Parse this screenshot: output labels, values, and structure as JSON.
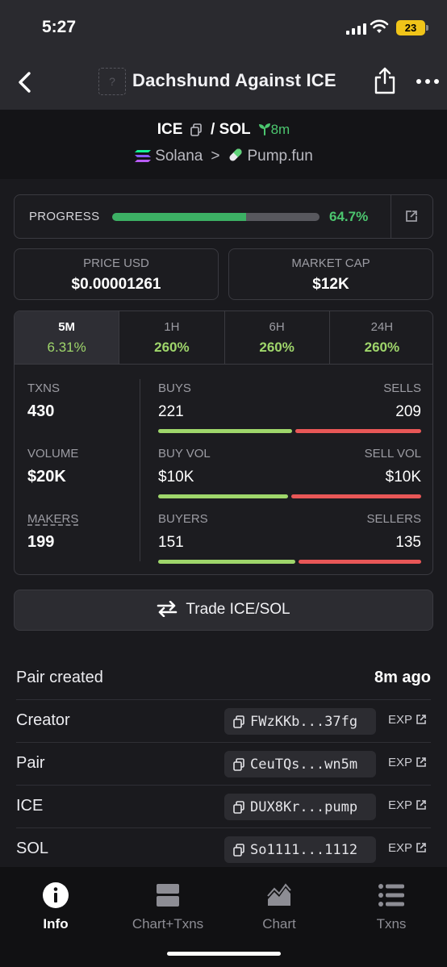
{
  "status_bar": {
    "time": "5:27",
    "battery": "23"
  },
  "nav": {
    "title": "Dachshund Against ICE",
    "token_placeholder": "?"
  },
  "pair": {
    "base": "ICE",
    "slash": "/",
    "quote": "SOL",
    "age": "8m",
    "chain": "Solana",
    "chevron": ">",
    "dex": "Pump.fun"
  },
  "progress": {
    "label": "PROGRESS",
    "percent_text": "64.7%",
    "fraction": 0.647
  },
  "price": {
    "label": "PRICE USD",
    "value": "$0.00001261"
  },
  "market_cap": {
    "label": "MARKET CAP",
    "value": "$12K"
  },
  "timeframes": [
    {
      "label": "5M",
      "change": "6.31%",
      "active": true
    },
    {
      "label": "1H",
      "change": "260%",
      "active": false
    },
    {
      "label": "6H",
      "change": "260%",
      "active": false
    },
    {
      "label": "24H",
      "change": "260%",
      "active": false
    }
  ],
  "metrics": {
    "txns": {
      "label": "TXNS",
      "value": "430"
    },
    "volume": {
      "label": "VOLUME",
      "value": "$20K"
    },
    "makers": {
      "label": "MAKERS",
      "value": "199"
    }
  },
  "splits": {
    "buys_sells": {
      "left_label": "BUYS",
      "right_label": "SELLS",
      "left_value": "221",
      "right_value": "209",
      "left_fraction": 0.514
    },
    "volume": {
      "left_label": "BUY VOL",
      "right_label": "SELL VOL",
      "left_value": "$10K",
      "right_value": "$10K",
      "left_fraction": 0.5
    },
    "buyers_sellers": {
      "left_label": "BUYERS",
      "right_label": "SELLERS",
      "left_value": "151",
      "right_value": "135",
      "left_fraction": 0.528
    }
  },
  "trade_button": {
    "label": "Trade ICE/SOL"
  },
  "info": {
    "pair_created": {
      "label": "Pair created",
      "value": "8m ago"
    },
    "rows": [
      {
        "label": "Creator",
        "address": "FWzKKb...37fg",
        "exp": "EXP"
      },
      {
        "label": "Pair",
        "address": "CeuTQs...wn5m",
        "exp": "EXP"
      },
      {
        "label": "ICE",
        "address": "DUX8Kr...pump",
        "exp": "EXP"
      },
      {
        "label": "SOL",
        "address": "So1111...1112",
        "exp": "EXP"
      }
    ]
  },
  "tabbar": [
    {
      "label": "Info",
      "icon": "info-icon",
      "active": true
    },
    {
      "label": "Chart+Txns",
      "icon": "chart-txns-icon",
      "active": false
    },
    {
      "label": "Chart",
      "icon": "area-chart-icon",
      "active": false
    },
    {
      "label": "Txns",
      "icon": "list-icon",
      "active": false
    }
  ],
  "colors": {
    "green": "#4cc66f",
    "lime": "#9fd66b",
    "red": "#e85757",
    "background": "#1a1a1e"
  }
}
